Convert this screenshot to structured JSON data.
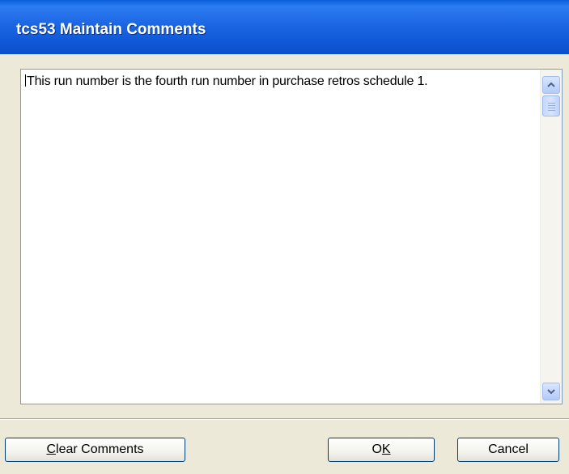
{
  "window": {
    "title": "tcs53 Maintain Comments"
  },
  "comment": {
    "text": "This run number is the fourth run number in purchase retros schedule 1."
  },
  "buttons": {
    "clear": {
      "accel": "C",
      "rest": "lear Comments"
    },
    "ok": {
      "before": "O",
      "accel": "K"
    },
    "cancel": {
      "label": "Cancel"
    }
  },
  "icons": {
    "scroll_up": "chevron-up-icon",
    "scroll_down": "chevron-down-icon",
    "thumb_grip": "grip-icon"
  },
  "colors": {
    "titlebar": "#1c66e3",
    "title_text": "#ffffff",
    "dialog_bg": "#ece9d8",
    "scroll_arrow": "#4d6185"
  }
}
